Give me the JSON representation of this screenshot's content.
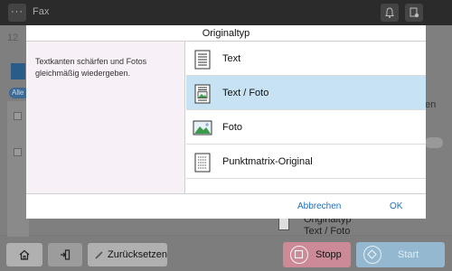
{
  "app": {
    "title": "Fax",
    "menu_dots": "···"
  },
  "background": {
    "field_text": "12",
    "pill_text": "Alle",
    "right_fragment": "en",
    "original_type_label": "Originaltyp",
    "original_type_value": "Text / Foto"
  },
  "dialog": {
    "title": "Originaltyp",
    "description": "Textkanten schärfen und Fotos gleichmäßig wiedergeben.",
    "options": [
      {
        "label": "Text",
        "icon": "text-document-icon",
        "selected": false
      },
      {
        "label": "Text / Foto",
        "icon": "text-photo-document-icon",
        "selected": true
      },
      {
        "label": "Foto",
        "icon": "photo-icon",
        "selected": false
      },
      {
        "label": "Punktmatrix-Original",
        "icon": "dot-matrix-document-icon",
        "selected": false
      }
    ],
    "cancel_label": "Abbrechen",
    "ok_label": "OK"
  },
  "bottom_bar": {
    "reset_label": "Zurücksetzen",
    "stop_label": "Stopp",
    "start_label": "Start"
  },
  "colors": {
    "selected_row": "#c7e3f3",
    "description_bg": "#f7f0f6",
    "link_blue": "#1a6fc4",
    "stop_button": "#cc8a96",
    "start_button": "#93b8cf"
  }
}
